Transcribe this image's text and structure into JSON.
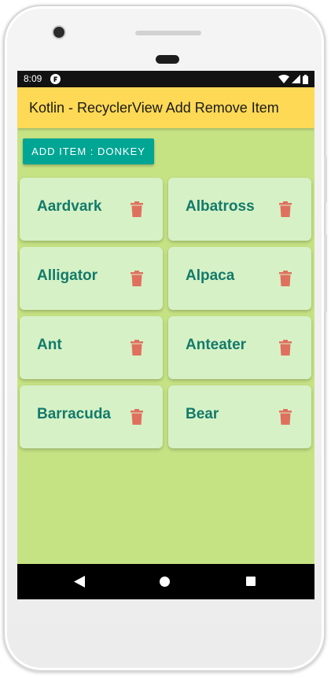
{
  "status_bar": {
    "time": "8:09"
  },
  "app_bar": {
    "title": "Kotlin - RecyclerView Add Remove Item",
    "color": "#fed955"
  },
  "add_button": {
    "label": "ADD ITEM : DONKEY",
    "color": "#00a594"
  },
  "items": [
    {
      "label": "Aardvark",
      "icon": "trash-icon"
    },
    {
      "label": "Albatross",
      "icon": "trash-icon"
    },
    {
      "label": "Alligator",
      "icon": "trash-icon"
    },
    {
      "label": "Alpaca",
      "icon": "trash-icon"
    },
    {
      "label": "Ant",
      "icon": "trash-icon"
    },
    {
      "label": "Anteater",
      "icon": "trash-icon"
    },
    {
      "label": "Barracuda",
      "icon": "trash-icon"
    },
    {
      "label": "Bear",
      "icon": "trash-icon"
    }
  ],
  "colors": {
    "screen_background": "#c6e384",
    "card_background": "#d6f1c6",
    "item_text": "#137a6a",
    "delete_icon": "#e0705e"
  },
  "nav_bar": {
    "icons": [
      "back-icon",
      "home-icon",
      "recents-icon"
    ]
  }
}
